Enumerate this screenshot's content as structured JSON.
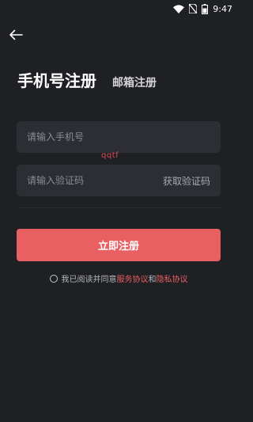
{
  "status_bar": {
    "time": "9:47",
    "battery_level": 0.6
  },
  "header": {
    "back_icon": "arrow-left-icon"
  },
  "tabs": {
    "active": "手机号注册",
    "inactive": "邮箱注册"
  },
  "form": {
    "phone_placeholder": "请输入手机号",
    "code_placeholder": "请输入验证码",
    "get_code_label": "获取验证码",
    "watermark_text": "qqtf"
  },
  "register_button": {
    "label": "立即注册"
  },
  "agreement": {
    "prefix": "我已阅读并同意",
    "service_link": "服务协议",
    "conjunction": "和",
    "privacy_link": "隐私协议"
  },
  "colors": {
    "background": "#1f2024",
    "field": "#2c2e33",
    "accent": "#e96062"
  }
}
